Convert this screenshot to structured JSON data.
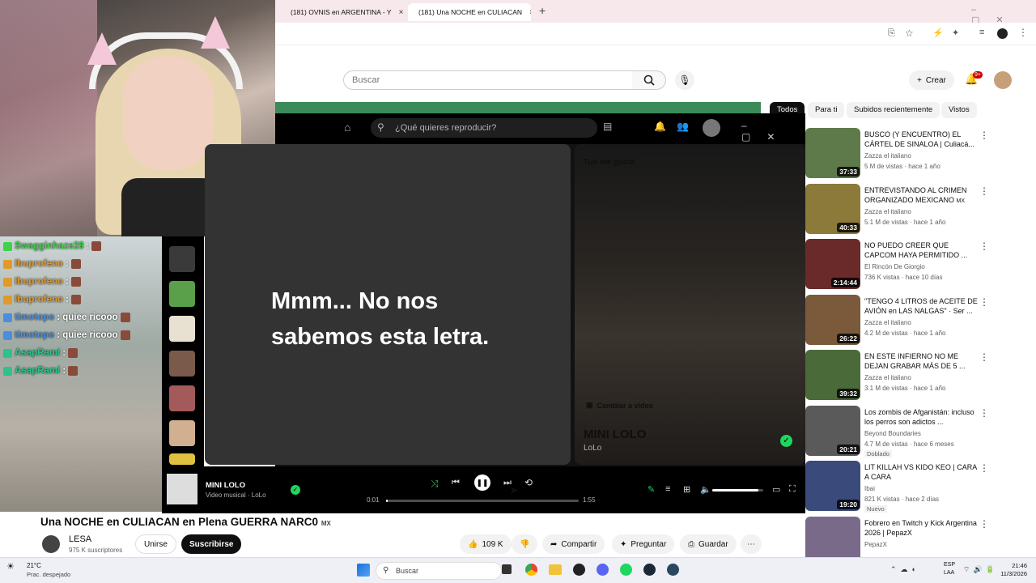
{
  "browser": {
    "tabs": [
      {
        "label": "(181) OVNIS en ARGENTINA - Y"
      },
      {
        "label": "(181) Una NOCHE en CULIACAN"
      }
    ]
  },
  "youtube": {
    "search_placeholder": "Buscar",
    "create_label": "Crear",
    "notif_count": "9+",
    "chips": [
      "Todos",
      "Para ti",
      "Subidos recientemente",
      "Vistos"
    ],
    "video_title": "Una NOCHE en CULIACAN en Plena GUERRA NARC0",
    "video_title_suffix": "MX",
    "channel": "LESA",
    "subscribers": "975 K suscriptores",
    "join_label": "Unirse",
    "subscribe_label": "Suscribirse",
    "likes": "109 K",
    "share_label": "Compartir",
    "ask_label": "Preguntar",
    "save_label": "Guardar",
    "recommendations": [
      {
        "title": "BUSCO (Y ENCUENTRO) EL CÁRTEL DE SINALOA | Culiacá...",
        "channel": "Zazza el italiano",
        "meta": "5 M de vistas · hace 1 año",
        "duration": "37:33",
        "color": "#5f7a4a"
      },
      {
        "title": "ENTREVISTANDO AL CRIMEN ORGANIZADO MEXICANO",
        "badge": "MX",
        "channel": "Zazza el italiano",
        "meta": "5.1 M de vistas · hace 1 año",
        "duration": "40:33",
        "color": "#8c7a3a"
      },
      {
        "title": "NO PUEDO CREER QUE CAPCOM HAYA PERMITIDO ...",
        "channel": "El Rincón De Giorgio",
        "meta": "736 K vistas · hace 10 días",
        "duration": "2:14:44",
        "color": "#6a2a2a"
      },
      {
        "title": "\"TENGO 4 LITROS de ACEITE DE AVIÓN en LAS NALGAS\" · Ser ...",
        "channel": "Zazza el italiano",
        "meta": "4.2 M de vistas · hace 1 año",
        "duration": "26:22",
        "color": "#7a5a3a"
      },
      {
        "title": "EN ESTE INFIERNO NO ME DEJAN GRABAR MÁS DE 5 ...",
        "channel": "Zazza el italiano",
        "meta": "3.1 M de vistas · hace 1 año",
        "duration": "39:32",
        "color": "#4a6a3a"
      },
      {
        "title": "Los zombis de Afganistán: incluso los perros son adictos ...",
        "channel": "Beyond Boundaries",
        "meta": "4.7 M de vistas · hace 6 meses",
        "duration": "20:21",
        "tag": "Doblado",
        "color": "#5a5a5a"
      },
      {
        "title": "LIT KILLAH VS KIDO KEO | CARA A CARA",
        "channel": "Ibai",
        "meta": "821 K vistas · hace 2 días",
        "duration": "19:20",
        "tag": "Nuevo",
        "color": "#3a4a7a"
      },
      {
        "title": "Fobrero en Twitch y Kick Argentina 2026 | PepazX",
        "channel": "PepazX",
        "meta": "",
        "duration": "",
        "color": "#7a6a8a"
      }
    ]
  },
  "spotify": {
    "search_placeholder": "¿Qué quieres reproducir?",
    "lyrics_message": "Mmm... No nos sabemos esta letra.",
    "panel_title": "Tus me gusta",
    "switch_video_label": "Cambiar a video",
    "track_title": "MINI LOLO",
    "track_artist": "LoLo",
    "player_title": "MINI LOLO",
    "player_subtitle": "Video musical · LoLo",
    "elapsed": "0:01",
    "duration": "1:55",
    "progress": 0.01,
    "volume": 0.9,
    "accent": "#1ed760"
  },
  "chat": {
    "messages": [
      {
        "user": "Swagginhaze28",
        "text": ":",
        "color": "#3fd24a"
      },
      {
        "user": "Ibuprofeno",
        "text": ":",
        "color": "#e09a2a"
      },
      {
        "user": "Ibuprofeno",
        "text": ":",
        "color": "#e09a2a"
      },
      {
        "user": "Ibuprofeno",
        "text": ":",
        "color": "#e09a2a"
      },
      {
        "user": "timotopo",
        "text": ": quiee ricooo",
        "color": "#4a8ee0"
      },
      {
        "user": "timotopo",
        "text": ": quiee ricooo",
        "color": "#4a8ee0"
      },
      {
        "user": "AsapRami",
        "text": ":",
        "color": "#2ec28a"
      },
      {
        "user": "AsapRami",
        "text": ":",
        "color": "#2ec28a"
      }
    ]
  },
  "taskbar": {
    "weather_temp": "21°C",
    "weather_desc": "Prac. despejado",
    "search_label": "Buscar",
    "lang": "ESP",
    "lang2": "LAA",
    "time": "21:46",
    "date": "11/3/2026"
  }
}
